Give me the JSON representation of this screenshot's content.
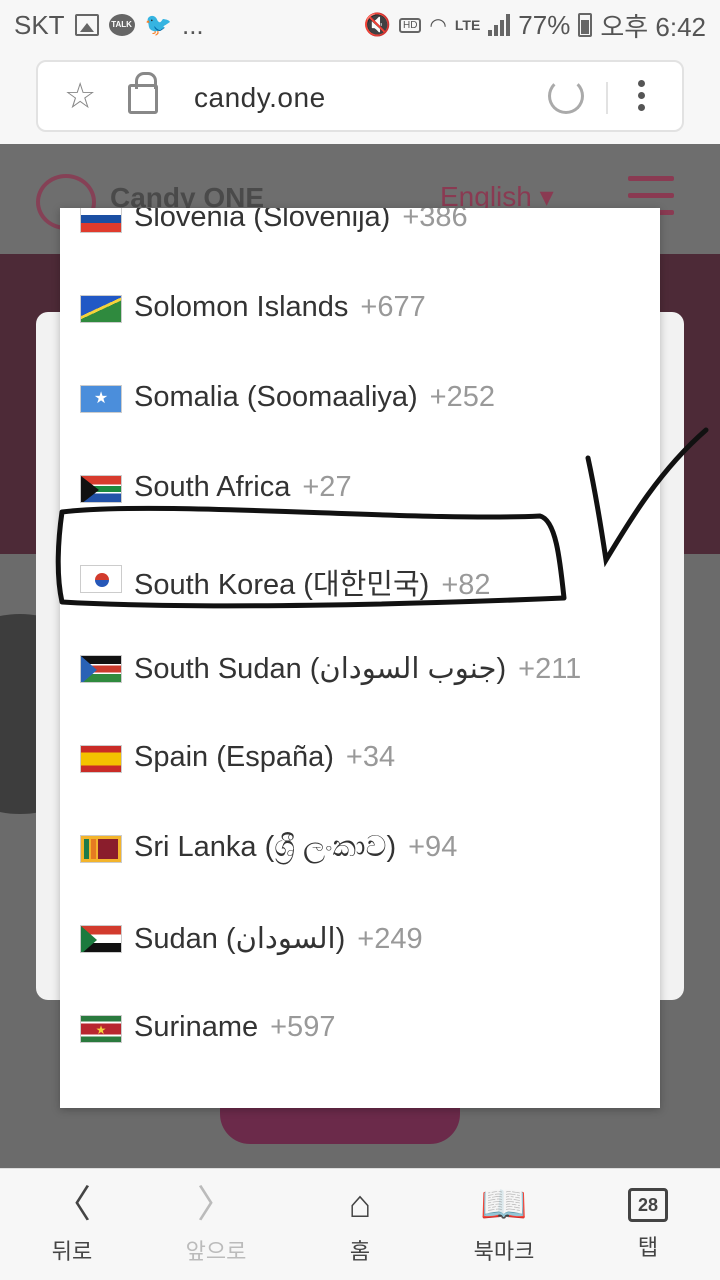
{
  "status_bar": {
    "carrier": "SKT",
    "ellipsis": "...",
    "talk": "TALK",
    "hd": "HD",
    "lte": "LTE",
    "battery_percent": "77%",
    "time": "오후 6:42"
  },
  "browser": {
    "url": "candy.one"
  },
  "site": {
    "logo_text": "Candy ONE",
    "language": "English ▾"
  },
  "countries": [
    {
      "name": "Slovenia (Slovenija)",
      "dial": "+386",
      "flag": "si"
    },
    {
      "name": "Solomon Islands",
      "dial": "+677",
      "flag": "sb"
    },
    {
      "name": "Somalia (Soomaaliya)",
      "dial": "+252",
      "flag": "so"
    },
    {
      "name": "South Africa",
      "dial": "+27",
      "flag": "za"
    },
    {
      "name": "South Korea (대한민국)",
      "dial": "+82",
      "flag": "kr",
      "highlighted": true
    },
    {
      "name": "South Sudan (جنوب السودان)",
      "dial": "+211",
      "flag": "ss"
    },
    {
      "name": "Spain (España)",
      "dial": "+34",
      "flag": "es"
    },
    {
      "name": "Sri Lanka (ශ්‍රී ලංකාව)",
      "dial": "+94",
      "flag": "lk"
    },
    {
      "name": "Sudan (السودان)",
      "dial": "+249",
      "flag": "sd"
    },
    {
      "name": "Suriname",
      "dial": "+597",
      "flag": "sr"
    }
  ],
  "bottom_nav": {
    "back": "뒤로",
    "forward": "앞으로",
    "home": "홈",
    "bookmarks": "북마크",
    "tabs": "탭",
    "tab_count": "28"
  },
  "colors": {
    "brand": "#8a3a52",
    "annotation": "#111111"
  }
}
